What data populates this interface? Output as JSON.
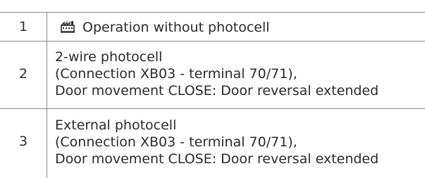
{
  "rows": [
    {
      "number": "1",
      "icon": "factory-setting-icon",
      "lines": [
        "Operation without photocell"
      ]
    },
    {
      "number": "2",
      "lines": [
        "2-wire photocell",
        "(Connection XB03 - terminal 70/71),",
        "Door movement CLOSE: Door reversal extended"
      ]
    },
    {
      "number": "3",
      "lines": [
        "External photocell",
        "(Connection XB03 - terminal 70/71),",
        "Door movement CLOSE: Door reversal extended"
      ]
    }
  ],
  "colors": {
    "grid": "#8c8c8c",
    "text": "#2b2b2b"
  }
}
